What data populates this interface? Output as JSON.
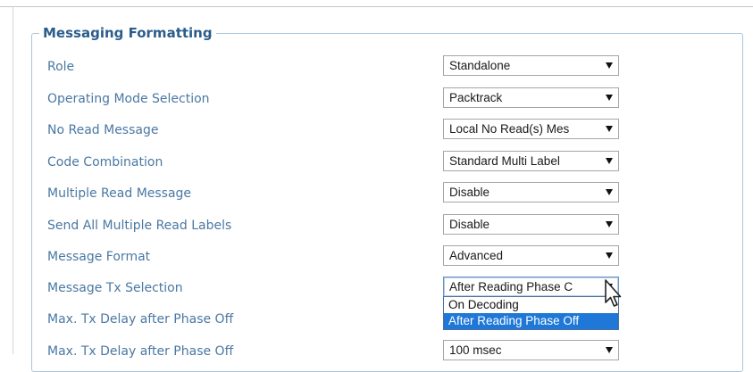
{
  "section": {
    "title": "Messaging Formatting"
  },
  "fields": [
    {
      "label": "Role",
      "value": "Standalone"
    },
    {
      "label": "Operating Mode Selection",
      "value": "Packtrack"
    },
    {
      "label": "No Read Message",
      "value": "Local No Read(s) Mes"
    },
    {
      "label": "Code Combination",
      "value": "Standard Multi Label"
    },
    {
      "label": "Multiple Read Message",
      "value": "Disable"
    },
    {
      "label": "Send All Multiple Read Labels",
      "value": "Disable"
    },
    {
      "label": "Message Format",
      "value": "Advanced"
    },
    {
      "label": "Message Tx Selection",
      "value": "After Reading Phase C"
    },
    {
      "label": "Max. Tx Delay after Phase Off"
    },
    {
      "label": "Max. Tx Delay after Phase Off",
      "value": "100 msec"
    }
  ],
  "open_dropdown": {
    "options": [
      "On Decoding",
      "After Reading Phase Off"
    ],
    "highlighted_index": 1
  },
  "colors": {
    "label": "#4a78a3",
    "legend": "#2a5d8c",
    "fieldset_border": "#a9c6de",
    "highlight": "#1f78d8"
  },
  "icons": [
    "chevron-down-icon",
    "mouse-cursor-icon"
  ]
}
